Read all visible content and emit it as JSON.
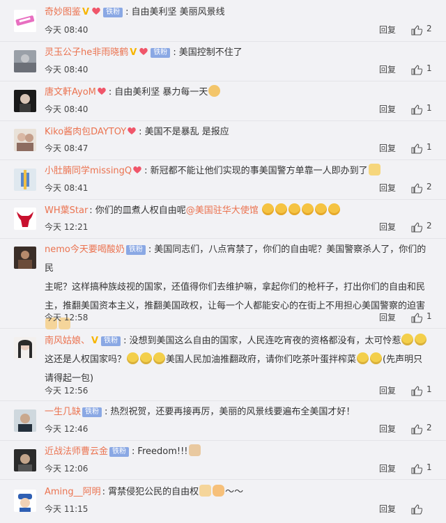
{
  "labels": {
    "reply": "回复"
  },
  "comments": [
    {
      "name": "奇妙图鉴",
      "v": "V",
      "fan": "",
      "text": "自由美利坚 美丽风景线",
      "time": "今天 08:40",
      "likes": "2"
    },
    {
      "name": "灵玉公子he非雨晓鹤",
      "v": "V",
      "fan": "",
      "text": "美国控制不住了",
      "time": "今天 08:40",
      "likes": "1"
    },
    {
      "name": "唐文軒AyoM",
      "v": "",
      "fan": "",
      "text": "自由美利坚 暴力每一天",
      "time": "今天 08:40",
      "likes": "1"
    },
    {
      "name": "Kiko酱肉包DAYTOY",
      "v": "",
      "fan": "",
      "text": "美国不是暴乱 是报应",
      "time": "今天 08:47",
      "likes": "1"
    },
    {
      "name": "小肚腩同学missingQ",
      "v": "",
      "fan": "",
      "text": "新冠都不能让他们实现的事美国警方单靠一人即办到了",
      "time": "今天 08:41",
      "likes": "2"
    },
    {
      "name": "WH葉Star",
      "v": "",
      "fan": "",
      "text": "你们的皿煮人权自由呢",
      "link": "@美国驻华大使馆",
      "time": "今天 12:21",
      "likes": "2"
    },
    {
      "name": "nemo今天要喝酸奶",
      "v": "",
      "fan": "铁粉",
      "line1": "美国同志们，八点宵禁了，你们的自由呢？美国警察杀人了，你们的民",
      "line2": "主呢？这样搞种族歧视的国家，还值得你们去维护嘛，拿起你们的枪杆子，打出你们的自由和民",
      "line3": "主，推翻美国资本主义，推翻美国政权，让每一个人都能安心的在街上不用担心美国警察的迫害",
      "time": "今天 12:58",
      "likes": "1"
    },
    {
      "name": "南风姑娘、",
      "v": "V",
      "fan": "铁粉",
      "line1": "没想到美国这么自由的国家，人民连吃宵夜的资格都没有，太可怜惹",
      "line2a": "这还是人权国家吗？",
      "line2b": "美国人民加油推翻政府，请你们吃茶叶蛋拌榨菜",
      "line2c": "(先声明只",
      "line3": "请得起一包)",
      "time": "今天 12:56",
      "likes": "1"
    },
    {
      "name": "一生几缺",
      "v": "",
      "fan": "铁粉",
      "text": "热烈祝贺，还要再接再厉，美丽的风景线要遍布全美国才好！",
      "time": "今天 12:46",
      "likes": "2"
    },
    {
      "name": "近战法师曹云金",
      "v": "",
      "fan": "铁粉",
      "text": "Freedom!!!",
      "time": "今天 12:06",
      "likes": "1"
    },
    {
      "name": "Aming__阿明",
      "v": "",
      "fan": "",
      "text": "霄禁侵犯公民的自由权",
      "tail": "～～",
      "time": "今天 11:15",
      "likes": ""
    }
  ]
}
